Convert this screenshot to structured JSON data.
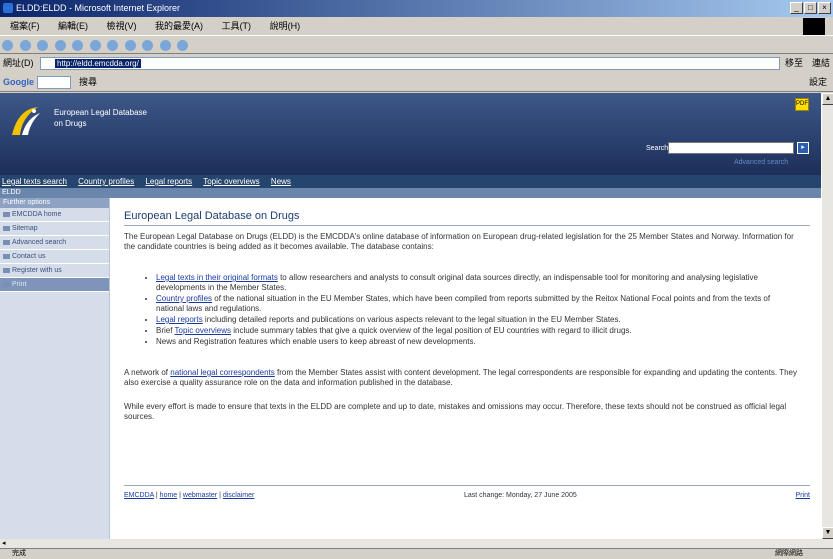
{
  "window": {
    "title": "ELDD:ELDD - Microsoft Internet Explorer",
    "controls": [
      "_",
      "□",
      "×"
    ]
  },
  "menu": [
    "檔案(F)",
    "編輯(E)",
    "檢視(V)",
    "我的最愛(A)",
    "工具(T)",
    "說明(H)"
  ],
  "address": {
    "label": "網址(D)",
    "url": "http://eldd.emcdda.org/",
    "go_label": "移至",
    "links_label": "連結"
  },
  "google_bar": {
    "brand": "Google",
    "search_label": "搜尋",
    "extra": "設定"
  },
  "site": {
    "title_line1": "European Legal Database",
    "title_line2": "on Drugs",
    "pdf_label": "PDF",
    "search_label": "Search",
    "search_go": "▸",
    "advanced_search": "Advanced search"
  },
  "nav": {
    "items": [
      "Legal texts search",
      "Country profiles",
      "Legal reports",
      "Topic overviews",
      "News"
    ]
  },
  "breadcrumb": "ELDD",
  "sidebar": {
    "heading": "Further options",
    "items": [
      "EMCDDA home",
      "Sitemap",
      "Advanced search",
      "Contact us",
      "Register with us",
      "Print"
    ]
  },
  "main": {
    "title": "European Legal Database on Drugs",
    "intro": "The European Legal Database on Drugs (ELDD) is the EMCDDA's online database of information on European drug-related legislation for the 25 Member States and Norway. Information for the candidate countries is being added as it becomes available. The database contains:",
    "features": [
      {
        "link": "Legal texts in their original formats",
        "text": " to allow researchers and analysts to consult original data sources directly, an indispensable tool for monitoring and analysing legislative developments in the Member States."
      },
      {
        "link": "Country profiles",
        "text": " of the national situation in the EU Member States, which have been compiled from reports submitted by the Reitox National Focal points and from the texts of national laws and regulations."
      },
      {
        "link": "Legal reports",
        "text": " including detailed reports and publications on various aspects relevant to the legal situation in the EU Member States."
      },
      {
        "link": "Topic overviews",
        "text": " include summary tables that give a quick overview of the legal position of EU countries with regard to illicit drugs.",
        "prefix": "Brief "
      },
      {
        "link": "",
        "text": "News and Registration features which enable users to keep abreast of new developments."
      }
    ],
    "network_link": "national legal correspondents",
    "network_prefix": "A network of ",
    "network_text": " from the Member States assist with content development. The legal correspondents are responsible for expanding and updating the contents. They also exercise a quality assurance role on the data and information published in the database.",
    "disclaimer": "While every effort is made to ensure that texts in the ELDD are complete and up to date, mistakes and omissions may occur. Therefore, these texts should not be construed as official legal sources."
  },
  "footer": {
    "links": [
      "EMCDDA",
      "home",
      "webmaster",
      "disclaimer"
    ],
    "last_change": "Last change: Monday, 27 June 2005",
    "print": "Print"
  },
  "status": {
    "text": "完成",
    "zone": "網際網路"
  }
}
